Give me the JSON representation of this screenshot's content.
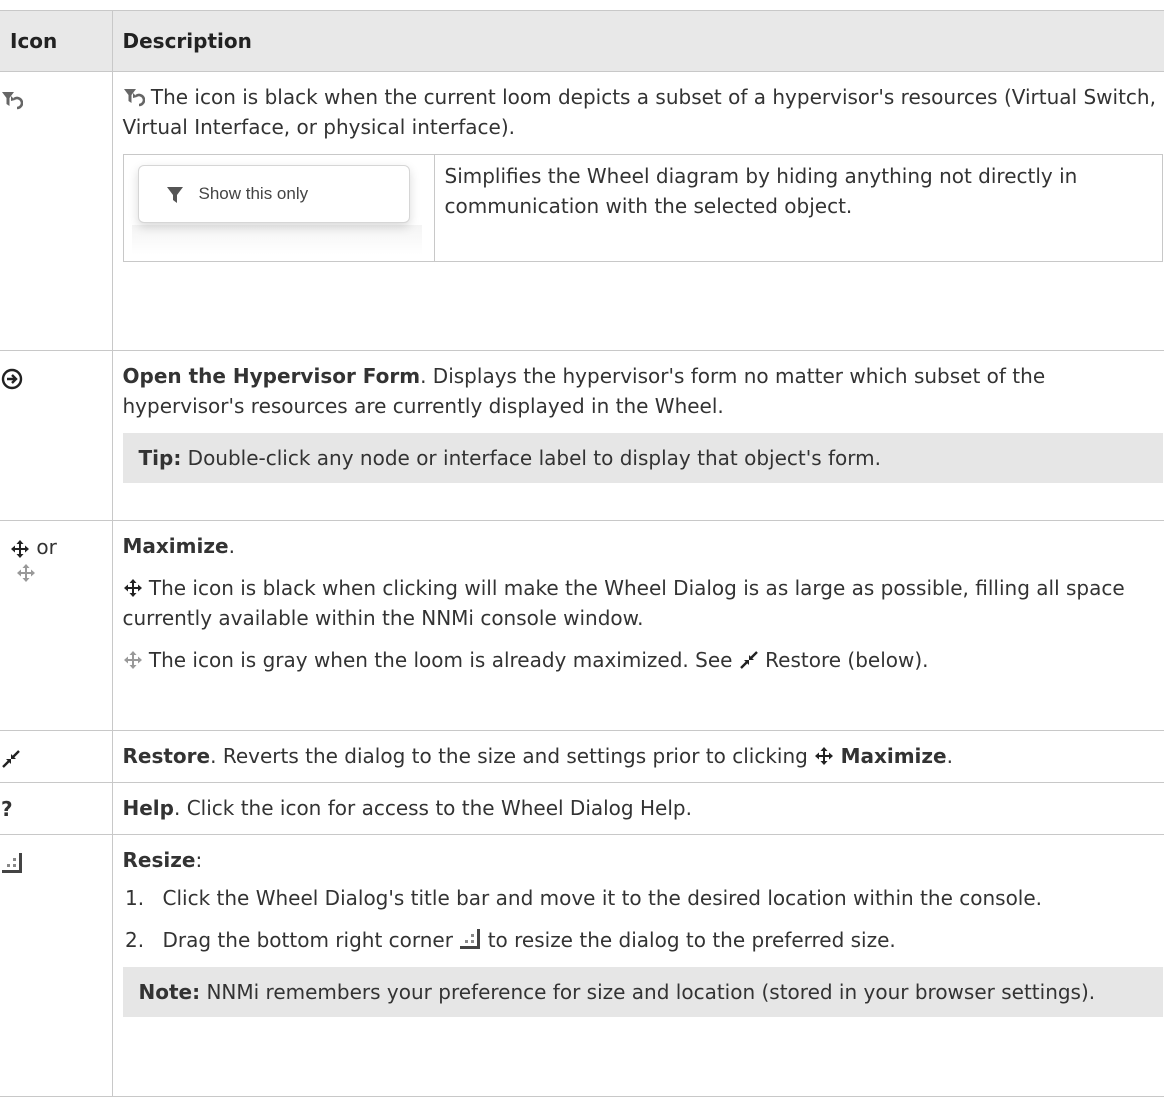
{
  "header": {
    "icon": "Icon",
    "description": "Description"
  },
  "rows": {
    "filter": {
      "icon": "filter-undo-icon",
      "text": "The icon is black when the current loom depicts a subset of a hypervisor's resources (Virtual Switch, Virtual Interface, or physical interface).",
      "button_label": "Show this only",
      "button_desc": "Simplifies the Wheel diagram by hiding anything not directly in communication with the selected object."
    },
    "open": {
      "icon": "open-form-icon",
      "bold": "Open the Hypervisor Form",
      "text": ". Displays the hypervisor's form no matter which subset of the hypervisor's resources are currently displayed in the Wheel.",
      "tip_label": "Tip:",
      "tip_text": " Double-click any node or interface label to display that object's form."
    },
    "maximize": {
      "icon_or": "or",
      "bold": "Maximize",
      "suffix": ".",
      "black_text": "The icon is black when clicking will make the Wheel Dialog is as large as possible, filling all space currently available within the NNMi console window.",
      "gray_text": "The icon is gray when the loom is already maximized. See",
      "gray_text_2": "Restore (below)."
    },
    "restore": {
      "bold": "Restore",
      "text": ". Reverts the dialog to the size and settings prior to clicking",
      "bold_2": "Maximize",
      "suffix": "."
    },
    "help": {
      "icon_glyph": "?",
      "bold": "Help",
      "text": ". Click the icon for access to the Wheel Dialog Help."
    },
    "resize": {
      "bold": "Resize",
      "suffix": ":",
      "step1": "Click the Wheel Dialog's title bar and move it to the desired location within the console.",
      "step2a": "Drag the bottom right corner",
      "step2b": "to resize the dialog to the preferred size.",
      "note_label": "Note:",
      "note_text": " NNMi remembers your preference for size and location (stored in your browser settings)."
    }
  },
  "colors": {
    "header_bg": "#e8e8e8",
    "tip_bg": "#e6e6e6",
    "border": "#c8c8c8",
    "text": "#333333"
  }
}
